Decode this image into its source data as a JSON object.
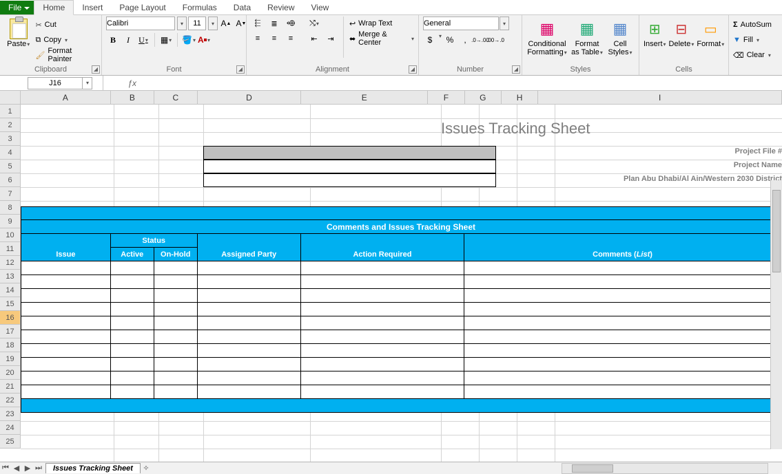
{
  "tabs": {
    "file": "File",
    "items": [
      "Home",
      "Insert",
      "Page Layout",
      "Formulas",
      "Data",
      "Review",
      "View"
    ],
    "active": "Home"
  },
  "ribbon": {
    "clipboard": {
      "paste": "Paste",
      "cut": "Cut",
      "copy": "Copy",
      "format_painter": "Format Painter",
      "label": "Clipboard"
    },
    "font": {
      "name": "Calibri",
      "size": "11",
      "label": "Font"
    },
    "alignment": {
      "wrap": "Wrap Text",
      "merge": "Merge & Center",
      "label": "Alignment"
    },
    "number": {
      "format": "General",
      "currency": "$",
      "percent": "%",
      "comma": ",",
      "inc": ".00→.0",
      "dec": ".0→.00",
      "label": "Number"
    },
    "styles": {
      "cond": "Conditional Formatting",
      "table": "Format as Table",
      "cell": "Cell Styles",
      "label": "Styles"
    },
    "cells": {
      "insert": "Insert",
      "delete": "Delete",
      "format": "Format",
      "label": "Cells"
    },
    "editing": {
      "autosum": "AutoSum",
      "fill": "Fill",
      "clear": "Clear"
    }
  },
  "namebox": "J16",
  "formula": "",
  "columns": [
    "A",
    "B",
    "C",
    "D",
    "E",
    "F",
    "G",
    "H",
    "I"
  ],
  "rows_visible": 25,
  "selected_row": 16,
  "sheet": {
    "title": "Issues Tracking Sheet",
    "labels": {
      "project_file": "Project File #",
      "project_name": "Project Name",
      "district": "Plan Abu Dhabi/Al Ain/Western 2030 District"
    },
    "values": {
      "project_file": "",
      "project_name": "",
      "district": ""
    },
    "table": {
      "title": "Comments and Issues Tracking Sheet",
      "headerA": "Issue",
      "headerStatus": "Status",
      "headerB": "Active",
      "headerC": "On-Hold",
      "headerD": "Assigned Party",
      "headerE": "Action Required",
      "headerI_prefix": "Comments (",
      "headerI_italic": "List",
      "headerI_suffix": " )"
    }
  },
  "tabs_bottom": {
    "active": "Issues Tracking Sheet"
  }
}
